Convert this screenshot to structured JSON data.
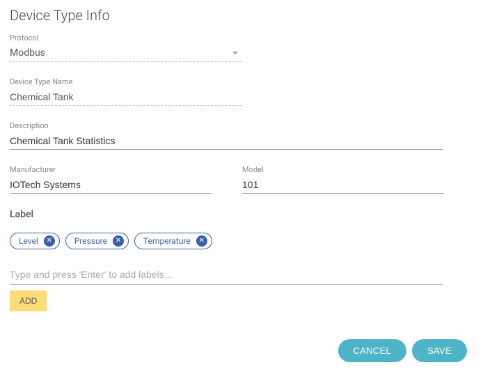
{
  "title": "Device Type Info",
  "fields": {
    "protocol": {
      "label": "Protocol",
      "value": "Modbus"
    },
    "deviceTypeName": {
      "label": "Device Type Name",
      "value": "Chemical Tank"
    },
    "description": {
      "label": "Description",
      "value": "Chemical Tank Statistics"
    },
    "manufacturer": {
      "label": "Manufacturer",
      "value": "IOTech Systems"
    },
    "model": {
      "label": "Model",
      "value": "101"
    }
  },
  "labelSection": {
    "heading": "Label",
    "chips": [
      "Level",
      "Pressure",
      "Temperature"
    ],
    "placeholder": "Type and press 'Enter' to add labels...",
    "addButton": "ADD"
  },
  "actions": {
    "cancel": "CANCEL",
    "save": "SAVE"
  }
}
